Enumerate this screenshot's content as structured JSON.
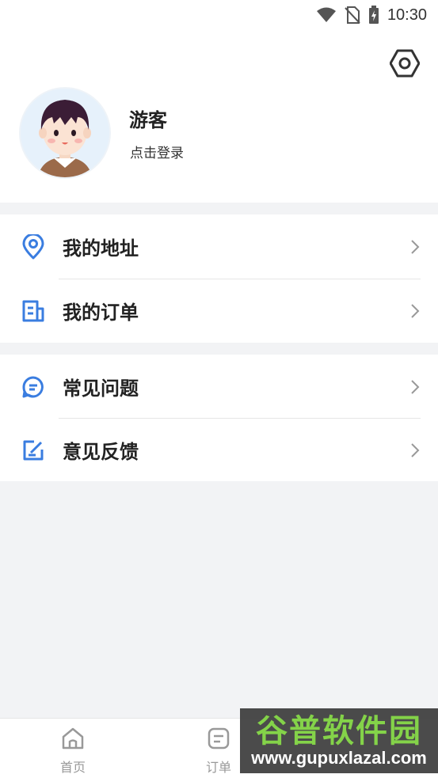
{
  "status_bar": {
    "time": "10:30",
    "icons": [
      "wifi-icon",
      "no-sim-icon",
      "battery-charging-icon"
    ]
  },
  "profile": {
    "username": "游客",
    "login_text": "点击登录",
    "settings_icon": "settings-hexagon-icon"
  },
  "menu": {
    "group1": [
      {
        "label": "我的地址",
        "icon": "location-pin-icon"
      },
      {
        "label": "我的订单",
        "icon": "order-doc-icon"
      }
    ],
    "group2": [
      {
        "label": "常见问题",
        "icon": "faq-chat-icon"
      },
      {
        "label": "意见反馈",
        "icon": "feedback-edit-icon"
      }
    ]
  },
  "tab_bar": {
    "tabs": [
      {
        "label": "首页",
        "icon": "home-icon"
      },
      {
        "label": "订单",
        "icon": "order-icon"
      }
    ]
  },
  "watermark": {
    "title": "谷普软件园",
    "url": "www.gupuxlazal.com"
  },
  "colors": {
    "accent": "#3a7de0",
    "background": "#f2f3f5",
    "tab_inactive": "#999999"
  }
}
